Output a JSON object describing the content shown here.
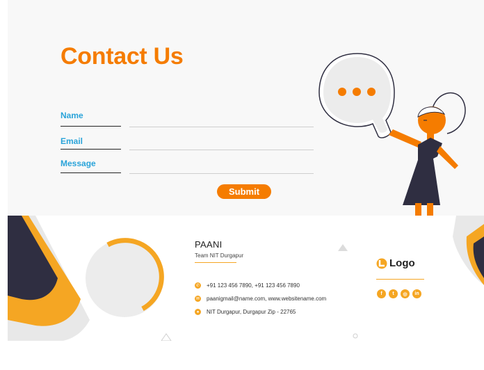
{
  "contact": {
    "title": "Contact Us",
    "fields": {
      "name_label": "Name",
      "email_label": "Email",
      "message_label": "Message"
    },
    "submit_label": "Submit"
  },
  "card": {
    "name": "PAANI",
    "team": "Team NIT Durgapur",
    "phone": "+91 123 456 7890, +91 123 456 7890",
    "email": "paanigmail@name.com, www.websitename.com",
    "address": "NIT Durgapur, Durgapur Zip - 22765",
    "logo_text": "Logo",
    "socials": [
      "facebook",
      "twitter",
      "instagram",
      "linkedin"
    ]
  },
  "colors": {
    "accent": "#f57c00",
    "label_blue": "#29a3d9",
    "card_accent": "#f5a623",
    "dark": "#2f2e41"
  },
  "icons": [
    "phone-icon",
    "mail-icon",
    "location-icon",
    "logo-mark-icon",
    "chat-bubble-icon"
  ]
}
